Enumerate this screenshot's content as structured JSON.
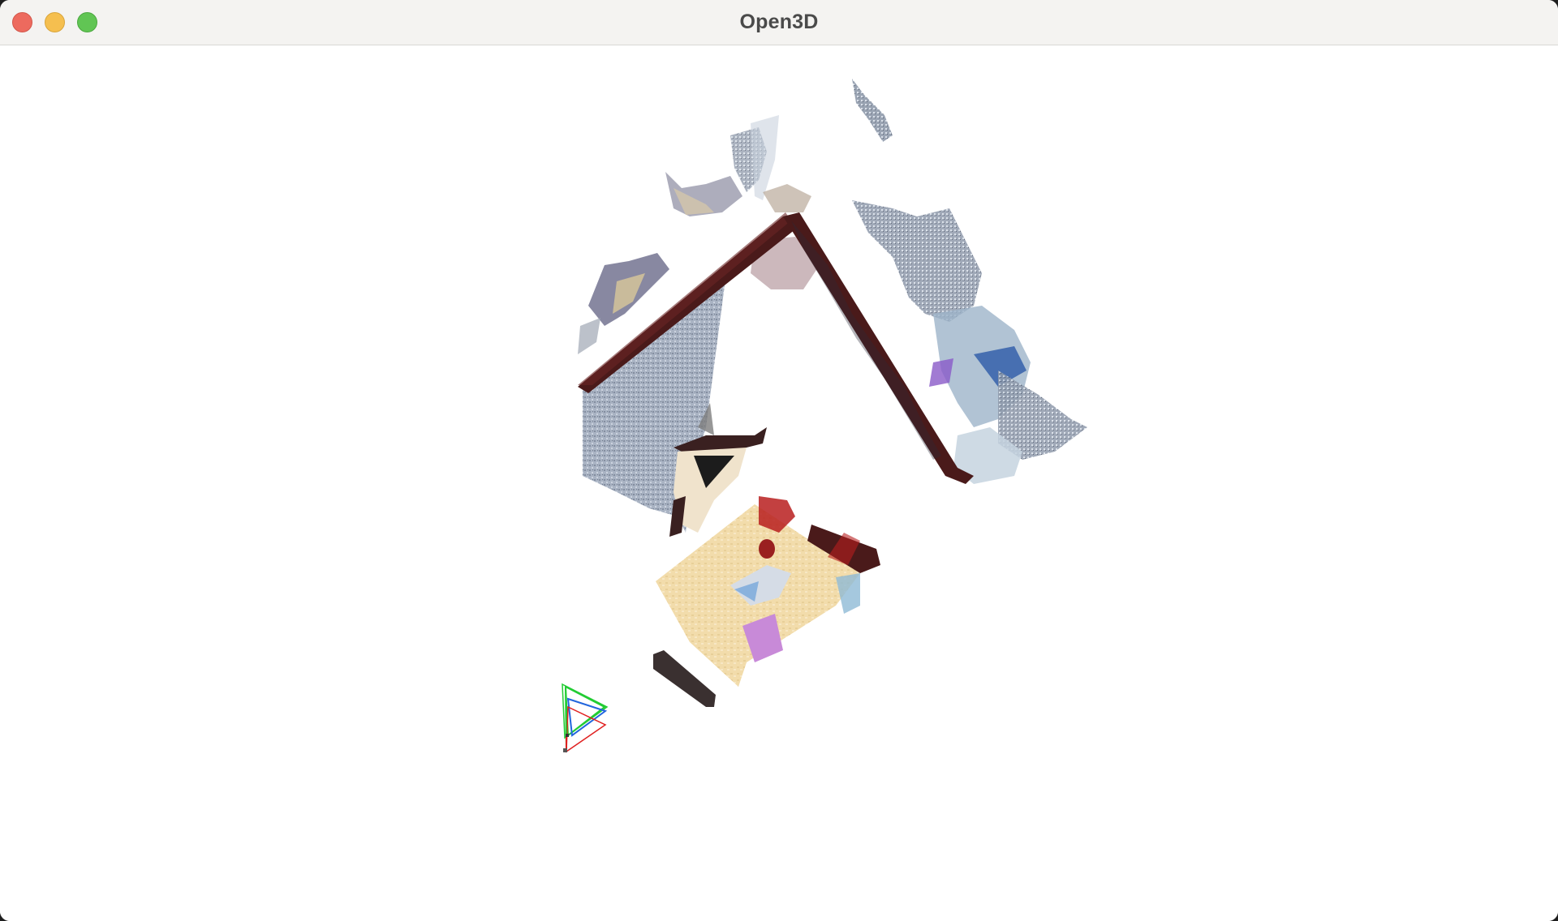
{
  "window": {
    "title": "Open3D"
  },
  "title_bar_buttons": {
    "close_icon": "close-icon",
    "minimize_icon": "minimize-icon",
    "zoom_icon": "zoom-icon"
  },
  "viewport": {
    "background_color": "#ffffff",
    "content": "point-cloud-scene",
    "camera_frustum_colors": [
      "#22cc33",
      "#e02020",
      "#2266dd"
    ]
  },
  "colors": {
    "close": "#ed6a5e",
    "minimize": "#f5bf4f",
    "zoom": "#61c554",
    "wall_edge": "#4a1a1a",
    "wall_plane": "#9aa5b8",
    "table_top": "#f3dfb2"
  }
}
